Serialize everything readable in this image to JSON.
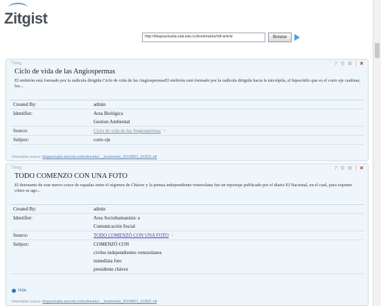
{
  "app": {
    "logo_text": "Zitgist"
  },
  "toolbar": {
    "url_value": "http://blogsactualia.utal.edu.cc/bookmarks/rdf-article",
    "browse_label": "Browse"
  },
  "cards": [
    {
      "tag": "Thing",
      "title": "Ciclo de vida de las Angiospermas",
      "description": "El embrión está formado por la radícula dirigida Ciclo de vida de las AngiospermasEl embrión está formado por la radícula dirigida hacia la micrópila, el hipocótilo que es el corto eje caulinar, los...",
      "props": {
        "created_by_label": "Created By:",
        "created_by": "admin",
        "identifier_label": "Identifier:",
        "identifiers": [
          "Area Biológica",
          "Gestion Ambiental"
        ],
        "source_label": "Source:",
        "source": "Ciclo de vida de las Angiospermas",
        "subject_label": "Subject:",
        "subjects": [
          "corto eje"
        ]
      },
      "footnote_label": "Information source:",
      "footnote_link": "blogsactualia.utal.edu.cc/bookmarks/..._bookmarks_20100821_163521.rdf"
    },
    {
      "tag": "Thing",
      "title": "TODO COMENZO CON UNA FOTO",
      "description": "El detonante de este nuevo cruce de espadas entre el régimen de Chávez y la prensa independiente venezolana fue un reportaje publicado por el diario El Nacional, en el cual, para exponer cómo se ago...",
      "props": {
        "created_by_label": "Created By:",
        "created_by": "admin",
        "identifier_label": "Identifier:",
        "identifiers": [
          "Area Sociohumanistic a",
          "Comunicación Social"
        ],
        "source_label": "Source:",
        "source": "TODO COMENZÓ CON UNA FOTO",
        "subject_label": "Subject:",
        "subjects": [
          "COMENZÓ CON",
          "civiles independientes venezolanos",
          "inmediata foto",
          "presidente chávez"
        ]
      },
      "hide_label": "Hide",
      "footnote_label": "Information source:",
      "footnote_link": "blogsactualia.utal.edu.cc/bookmarks/..._bookmarks_20100821_163521.rdf"
    }
  ]
}
